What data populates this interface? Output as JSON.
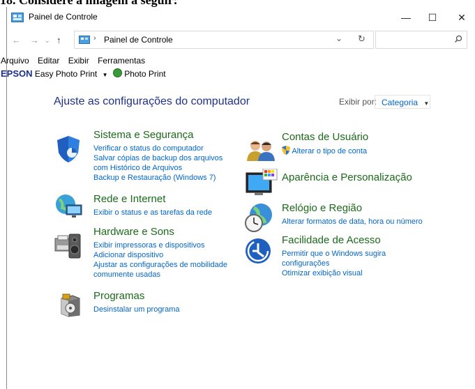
{
  "question": "18.   Considere a imagem a seguir:",
  "window": {
    "title": "Painel de Controle",
    "controls": {
      "minimize": "—",
      "maximize": "☐",
      "close": "✕"
    }
  },
  "address": {
    "breadcrumb": "Painel de Controle"
  },
  "menu": [
    "Arquivo",
    "Editar",
    "Exibir",
    "Ferramentas"
  ],
  "epson": {
    "brand": "EPSON",
    "easy_print": "Easy Photo Print",
    "photo_print": "Photo Print"
  },
  "heading": "Ajuste as configurações do computador",
  "view_by": {
    "label": "Exibir por:",
    "value": "Categoria"
  },
  "categories": {
    "system": {
      "title": "Sistema e Segurança",
      "links": [
        "Verificar o status do computador",
        "Salvar cópias de backup dos arquivos",
        "com Histórico de Arquivos",
        "Backup e Restauração (Windows 7)"
      ]
    },
    "network": {
      "title": "Rede e Internet",
      "links": [
        "Exibir o status e as tarefas da rede"
      ]
    },
    "hardware": {
      "title": "Hardware e Sons",
      "links": [
        "Exibir impressoras e dispositivos",
        "Adicionar dispositivo",
        "Ajustar as configurações de mobilidade",
        "comumente usadas"
      ]
    },
    "programs": {
      "title": "Programas",
      "links": [
        "Desinstalar um programa"
      ]
    },
    "accounts": {
      "title": "Contas de Usuário",
      "links": [
        "Alterar o tipo de conta"
      ]
    },
    "appearance": {
      "title": "Aparência e Personalização",
      "links": []
    },
    "clock": {
      "title": "Relógio e Região",
      "links": [
        "Alterar formatos de data, hora ou número"
      ]
    },
    "ease": {
      "title": "Facilidade de Acesso",
      "links": [
        "Permitir que o Windows sugira",
        "configurações",
        "Otimizar exibição visual"
      ]
    }
  }
}
